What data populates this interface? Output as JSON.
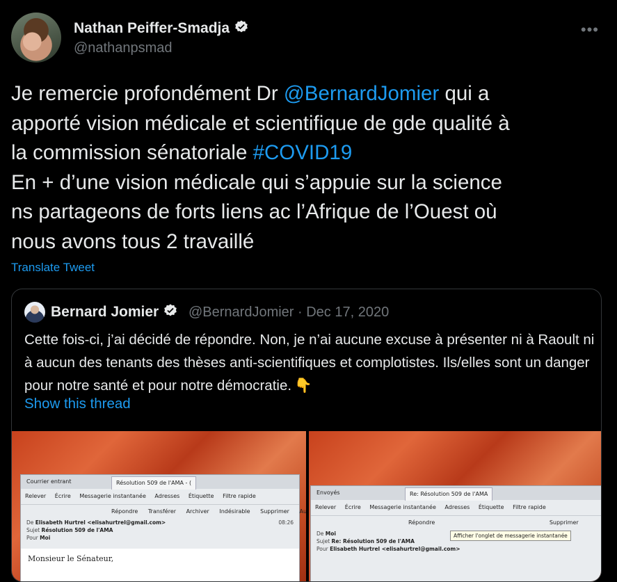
{
  "tweet": {
    "author_name": "Nathan Peiffer-Smadja",
    "author_handle": "@nathanpsmad",
    "more_label": "•••",
    "text_part1": "Je remercie profondément Dr ",
    "mention": "@BernardJomier",
    "text_part2": " qui a\napporté vision médicale et scientifique de gde qualité à\nla commission sénatoriale ",
    "hashtag": "#COVID19",
    "text_part3": "\nEn + d’une vision médicale qui s’appuie sur la science\nns partageons de forts liens ac l’Afrique de l’Ouest où\nnous avons tous 2 travaillé",
    "translate_label": "Translate Tweet"
  },
  "quote": {
    "author_name": "Bernard Jomier",
    "meta": "@BernardJomier · Dec 17, 2020",
    "text": "Cette fois-ci, j’ai décidé de répondre. Non, je n’ai aucune excuse à présenter ni à Raoult ni à aucun des tenants des thèses anti-scientifiques et complotistes. Ils/elles sont un danger pour notre santé et pour notre démocratie.",
    "emoji": "👇",
    "thread_label": "Show this thread"
  },
  "image_left": {
    "tab_inbox": "Courrier entrant",
    "tab_active": "Résolution 509 de l'AMA - (",
    "toolbar": [
      "Relever",
      "Écrire",
      "Messagerie instantanée",
      "Adresses",
      "Étiquette",
      "Filtre rapide"
    ],
    "actions": [
      "Répondre",
      "Transférer",
      "Archiver",
      "Indésirable",
      "Supprimer",
      "Autres"
    ],
    "from_label": "De",
    "from_value": "Elisabeth Hurtrel <elisahurtrel@gmail.com>",
    "subject_label": "Sujet",
    "subject_value": "Résolution 509 de l'AMA",
    "to_label": "Pour",
    "to_value": "Moi",
    "time": "08:26",
    "body": "Monsieur le Sénateur,"
  },
  "image_right": {
    "tab_sent": "Envoyés",
    "tab_active": "Re: Résolution 509 de l'AMA",
    "toolbar": [
      "Relever",
      "Écrire",
      "Messagerie instantanée",
      "Adresses",
      "Étiquette",
      "Filtre rapide"
    ],
    "tooltip": "Afficher l'onglet de messagerie instantanée",
    "actions": [
      "Répondre",
      "Supprimer"
    ],
    "from_label": "De",
    "from_value": "Moi",
    "subject_label": "Sujet",
    "subject_value": "Re: Résolution 509 de l'AMA",
    "to_label": "Pour",
    "to_value": "Elisabeth Hurtrel <elisahurtrel@gmail.com>"
  },
  "colors": {
    "background": "#000000",
    "text": "#e7e9ea",
    "muted": "#71767b",
    "link": "#1d9bf0",
    "border": "#333639"
  }
}
